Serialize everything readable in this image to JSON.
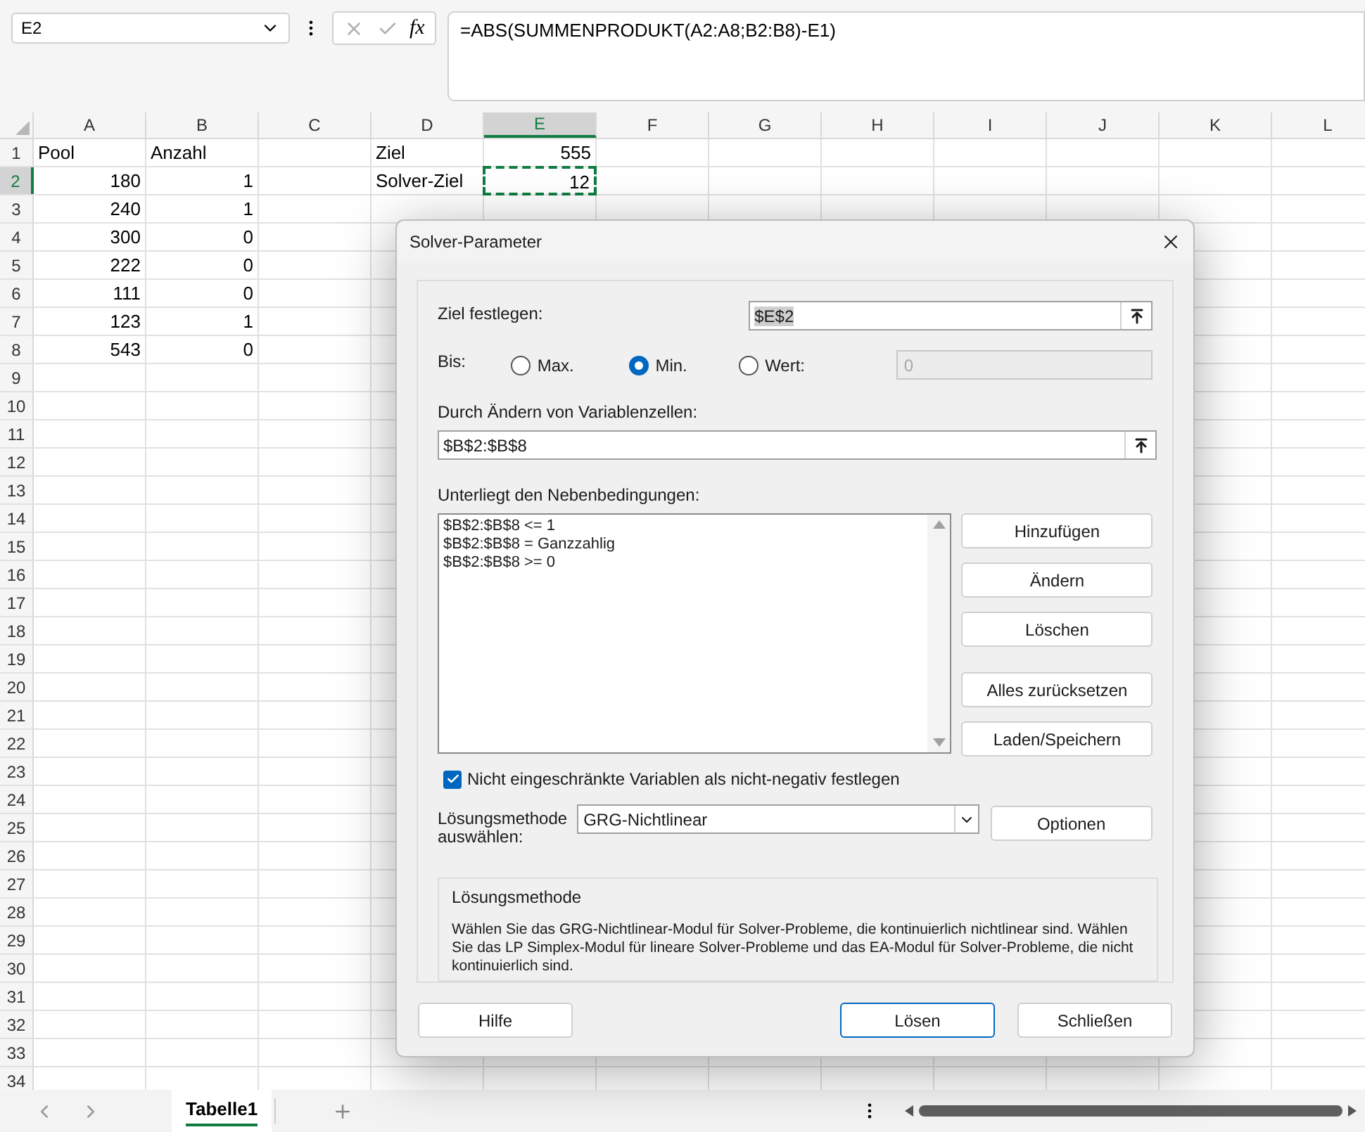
{
  "formula_bar": {
    "name_box": "E2",
    "function_label": "fx",
    "formula": "=ABS(SUMMENPRODUKT(A2:A8;B2:B8)-E1)"
  },
  "columns": [
    {
      "label": "A",
      "selected": false
    },
    {
      "label": "B",
      "selected": false
    },
    {
      "label": "C",
      "selected": false
    },
    {
      "label": "D",
      "selected": false
    },
    {
      "label": "E",
      "selected": true
    },
    {
      "label": "F",
      "selected": false
    },
    {
      "label": "G",
      "selected": false
    },
    {
      "label": "H",
      "selected": false
    },
    {
      "label": "I",
      "selected": false
    },
    {
      "label": "J",
      "selected": false
    },
    {
      "label": "K",
      "selected": false
    },
    {
      "label": "L",
      "selected": false
    }
  ],
  "rows": [
    {
      "header": "1",
      "selected": false
    },
    {
      "header": "2",
      "selected": true
    },
    {
      "header": "3",
      "selected": false
    },
    {
      "header": "4",
      "selected": false
    },
    {
      "header": "5",
      "selected": false
    },
    {
      "header": "6",
      "selected": false
    },
    {
      "header": "7",
      "selected": false
    },
    {
      "header": "8",
      "selected": false
    },
    {
      "header": "9",
      "selected": false
    },
    {
      "header": "10",
      "selected": false
    },
    {
      "header": "11",
      "selected": false
    },
    {
      "header": "12",
      "selected": false
    },
    {
      "header": "13",
      "selected": false
    },
    {
      "header": "14",
      "selected": false
    },
    {
      "header": "15",
      "selected": false
    },
    {
      "header": "16",
      "selected": false
    },
    {
      "header": "17",
      "selected": false
    },
    {
      "header": "18",
      "selected": false
    },
    {
      "header": "19",
      "selected": false
    },
    {
      "header": "20",
      "selected": false
    },
    {
      "header": "21",
      "selected": false
    },
    {
      "header": "22",
      "selected": false
    },
    {
      "header": "23",
      "selected": false
    },
    {
      "header": "24",
      "selected": false
    },
    {
      "header": "25",
      "selected": false
    },
    {
      "header": "26",
      "selected": false
    },
    {
      "header": "27",
      "selected": false
    },
    {
      "header": "28",
      "selected": false
    },
    {
      "header": "29",
      "selected": false
    },
    {
      "header": "30",
      "selected": false
    },
    {
      "header": "31",
      "selected": false
    },
    {
      "header": "32",
      "selected": false
    },
    {
      "header": "33",
      "selected": false
    },
    {
      "header": "34",
      "selected": false
    }
  ],
  "pool_table": [
    [
      {
        "text": "Pool",
        "kind": "text",
        "selected": false
      },
      {
        "text": "Anzahl",
        "kind": "text",
        "selected": false
      }
    ],
    [
      {
        "text": "180",
        "kind": "number",
        "selected": false
      },
      {
        "text": "1",
        "kind": "number",
        "selected": false
      }
    ],
    [
      {
        "text": "240",
        "kind": "number",
        "selected": false
      },
      {
        "text": "1",
        "kind": "number",
        "selected": false
      }
    ],
    [
      {
        "text": "300",
        "kind": "number",
        "selected": false
      },
      {
        "text": "0",
        "kind": "number",
        "selected": false
      }
    ],
    [
      {
        "text": "222",
        "kind": "number",
        "selected": false
      },
      {
        "text": "0",
        "kind": "number",
        "selected": false
      }
    ],
    [
      {
        "text": "111",
        "kind": "number",
        "selected": false
      },
      {
        "text": "0",
        "kind": "number",
        "selected": false
      }
    ],
    [
      {
        "text": "123",
        "kind": "number",
        "selected": false
      },
      {
        "text": "1",
        "kind": "number",
        "selected": false
      }
    ],
    [
      {
        "text": "543",
        "kind": "number",
        "selected": false
      },
      {
        "text": "0",
        "kind": "number",
        "selected": false
      }
    ]
  ],
  "goal_table": [
    [
      {
        "text": "Ziel",
        "kind": "text",
        "selected": false
      },
      {
        "text": "555",
        "kind": "number",
        "selected": false
      }
    ],
    [
      {
        "text": "Solver-Ziel",
        "kind": "text",
        "selected": false
      },
      {
        "text": "12",
        "kind": "number",
        "selected": true
      }
    ]
  ],
  "dialog": {
    "title": "Solver-Parameter",
    "target": {
      "label": "Ziel festlegen:",
      "value": "$E$2"
    },
    "to": {
      "label": "Bis:",
      "options": [
        {
          "label": "Max.",
          "selected": false
        },
        {
          "label": "Min.",
          "selected": true
        },
        {
          "label": "Wert:",
          "selected": false
        }
      ],
      "value": "0",
      "disabled": true
    },
    "variables": {
      "label": "Durch Ändern von Variablenzellen:",
      "value": "$B$2:$B$8"
    },
    "constraints": {
      "label": "Unterliegt den Nebenbedingungen:",
      "items": [
        "$B$2:$B$8 <= 1",
        "$B$2:$B$8 = Ganzzahlig",
        "$B$2:$B$8 >= 0"
      ]
    },
    "side_buttons": [
      "Hinzufügen",
      "Ändern",
      "Löschen",
      "Alles zurücksetzen",
      "Laden/Speichern"
    ],
    "nonnegative": {
      "label": "Nicht eingeschränkte Variablen als nicht-negativ festlegen",
      "checked": true
    },
    "method": {
      "label": "Lösungsmethode auswählen:",
      "value": "GRG-Nichtlinear",
      "button": "Optionen"
    },
    "description": {
      "title": "Lösungsmethode",
      "text": "Wählen Sie das GRG-Nichtlinear-Modul für Solver-Probleme, die kontinuierlich nichtlinear sind. Wählen Sie das LP Simplex-Modul für lineare Solver-Probleme und das EA-Modul für Solver-Probleme, die nicht kontinuierlich sind."
    },
    "footer_buttons": [
      {
        "label": "Hilfe",
        "kind": "normal"
      },
      {
        "label": "Lösen",
        "kind": "default"
      },
      {
        "label": "Schließen",
        "kind": "normal"
      }
    ]
  },
  "sheet_tabs": [
    {
      "label": "Tabelle1",
      "selected": true
    }
  ]
}
